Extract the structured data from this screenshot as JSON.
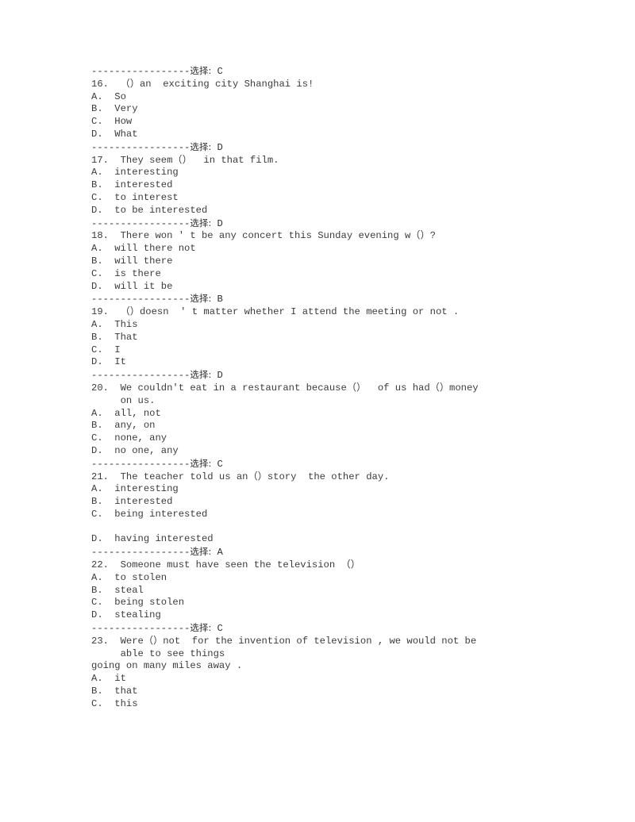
{
  "document": {
    "type": "exam-answer-sheet",
    "language": "en-with-zh-annotations",
    "answer_label": "选择:",
    "separator_dashes": "-----------------",
    "blocks": [
      {
        "kind": "separator",
        "answer": "C"
      },
      {
        "kind": "question",
        "number": "16.",
        "stem_lines": [
          "（）an  exciting city Shanghai is!"
        ],
        "options": [
          {
            "letter": "A.",
            "text": "So"
          },
          {
            "letter": "B.",
            "text": "Very"
          },
          {
            "letter": "C.",
            "text": "How"
          },
          {
            "letter": "D.",
            "text": "What"
          }
        ]
      },
      {
        "kind": "separator",
        "answer": "D"
      },
      {
        "kind": "question",
        "number": "17.",
        "stem_lines": [
          "They seem（）  in that film."
        ],
        "options": [
          {
            "letter": "A.",
            "text": "interesting"
          },
          {
            "letter": "B.",
            "text": "interested"
          },
          {
            "letter": "C.",
            "text": "to interest"
          },
          {
            "letter": "D.",
            "text": "to be interested"
          }
        ]
      },
      {
        "kind": "separator",
        "answer": "D"
      },
      {
        "kind": "question",
        "number": "18.",
        "stem_lines": [
          "There won ' t be any concert this Sunday evening w（）?"
        ],
        "options": [
          {
            "letter": "A.",
            "text": "will there not"
          },
          {
            "letter": "B.",
            "text": "will there"
          },
          {
            "letter": "C.",
            "text": "is there"
          },
          {
            "letter": "D.",
            "text": "will it be"
          }
        ]
      },
      {
        "kind": "separator",
        "answer": "B"
      },
      {
        "kind": "question",
        "number": "19.",
        "stem_lines": [
          "（）doesn  ' t matter whether I attend the meeting or not ."
        ],
        "options": [
          {
            "letter": "A.",
            "text": "This"
          },
          {
            "letter": "B.",
            "text": "That"
          },
          {
            "letter": "C.",
            "text": "I"
          },
          {
            "letter": "D.",
            "text": "It"
          }
        ]
      },
      {
        "kind": "separator",
        "answer": "D"
      },
      {
        "kind": "question",
        "number": "20.",
        "stem_lines": [
          "We couldn't eat in a restaurant because（）  of us had（）money",
          "on us."
        ],
        "options": [
          {
            "letter": "A.",
            "text": "all, not"
          },
          {
            "letter": "B.",
            "text": "any, on"
          },
          {
            "letter": "C.",
            "text": "none, any"
          },
          {
            "letter": "D.",
            "text": "no one, any"
          }
        ]
      },
      {
        "kind": "separator",
        "answer": "C"
      },
      {
        "kind": "question",
        "number": "21.",
        "stem_lines": [
          "The teacher told us an（）story  the other day."
        ],
        "options": [
          {
            "letter": "A.",
            "text": "interesting"
          },
          {
            "letter": "B.",
            "text": "interested"
          },
          {
            "letter": "C.",
            "text": "being interested"
          },
          {
            "letter": "",
            "text": "",
            "blank": true
          },
          {
            "letter": "D.",
            "text": "having interested"
          }
        ]
      },
      {
        "kind": "separator",
        "answer": "A"
      },
      {
        "kind": "question",
        "number": "22.",
        "stem_lines": [
          "Someone must have seen the television （）"
        ],
        "options": [
          {
            "letter": "A.",
            "text": "to stolen"
          },
          {
            "letter": "B.",
            "text": "steal"
          },
          {
            "letter": "C.",
            "text": "being stolen"
          },
          {
            "letter": "D.",
            "text": "stealing"
          }
        ]
      },
      {
        "kind": "separator",
        "answer": "C"
      },
      {
        "kind": "question",
        "number": "23.",
        "stem_lines": [
          "Were（）not  for the invention of television , we would not be",
          "able to see things"
        ],
        "continuation": "going on many miles away .",
        "options": [
          {
            "letter": "A.",
            "text": "it"
          },
          {
            "letter": "B.",
            "text": "that"
          },
          {
            "letter": "C.",
            "text": "this"
          }
        ]
      }
    ]
  }
}
